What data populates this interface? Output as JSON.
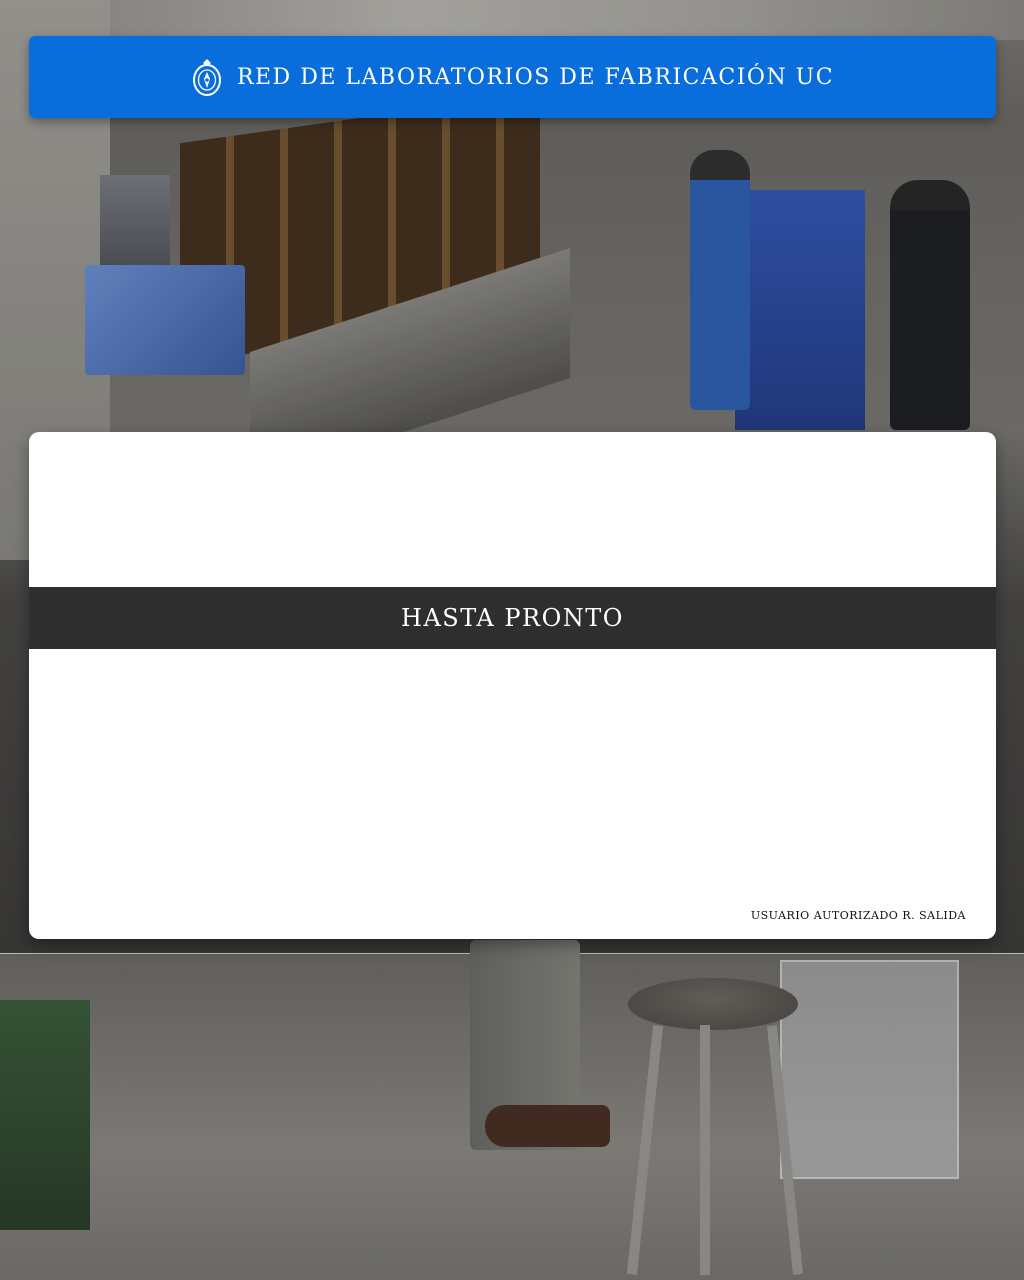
{
  "header": {
    "logo_icon": "university-seal-icon",
    "title": "RED DE LABORATORIOS DE FABRICACIÓN UC",
    "color": "#0a6ddc"
  },
  "card": {
    "banner": "HASTA PRONTO",
    "banner_color": "#2e2e2e",
    "status": "USUARIO AUTORIZADO R. SALIDA"
  }
}
